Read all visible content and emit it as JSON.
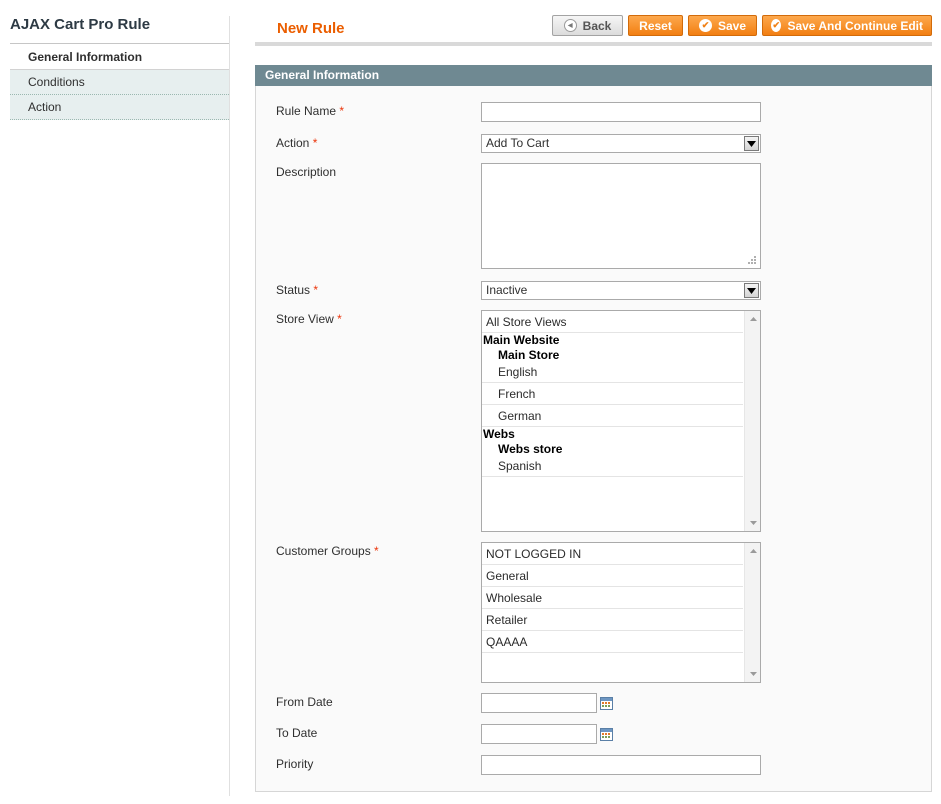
{
  "sidebar": {
    "title": "AJAX Cart Pro Rule",
    "tabs": [
      {
        "label": "General Information",
        "active": true
      },
      {
        "label": "Conditions",
        "active": false
      },
      {
        "label": "Action",
        "active": false
      }
    ]
  },
  "header": {
    "title": "New Rule",
    "buttons": {
      "back": "Back",
      "reset": "Reset",
      "save": "Save",
      "save_continue": "Save And Continue Edit"
    }
  },
  "fieldset": {
    "title": "General Information"
  },
  "form": {
    "rule_name": {
      "label": "Rule Name",
      "value": "",
      "required": "*"
    },
    "action": {
      "label": "Action",
      "value": "Add To Cart",
      "required": "*"
    },
    "description": {
      "label": "Description",
      "value": ""
    },
    "status": {
      "label": "Status",
      "value": "Inactive",
      "required": "*"
    },
    "store_view": {
      "label": "Store View",
      "required": "*",
      "all": "All Store Views",
      "website1": "Main Website",
      "store1": "Main Store",
      "views1": [
        "English",
        "French",
        "German"
      ],
      "website2": "Webs",
      "store2": "Webs store",
      "views2": [
        "Spanish"
      ]
    },
    "customer_groups": {
      "label": "Customer Groups",
      "required": "*",
      "options": [
        "NOT LOGGED IN",
        "General",
        "Wholesale",
        "Retailer",
        "QAAAA"
      ]
    },
    "from_date": {
      "label": "From Date",
      "value": ""
    },
    "to_date": {
      "label": "To Date",
      "value": ""
    },
    "priority": {
      "label": "Priority",
      "value": ""
    }
  },
  "colors": {
    "accent_orange": "#eb5e00",
    "button_orange": "#f27f12",
    "fieldset_header": "#6f8992",
    "tab_background": "#e7efef",
    "required_star": "#eb340a"
  },
  "icons": {
    "back": "circle-left-arrow-icon",
    "save": "check-circle-icon",
    "calendar": "calendar-icon",
    "select": "chevron-down-icon"
  }
}
